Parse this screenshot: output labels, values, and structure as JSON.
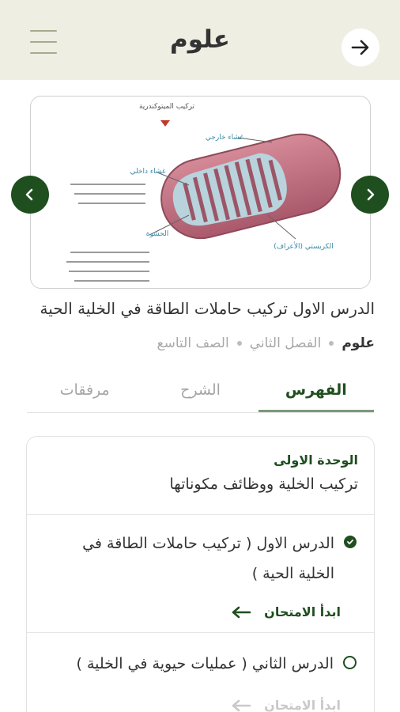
{
  "header": {
    "title": "علوم",
    "menu_icon": "hamburger-icon",
    "back_icon": "arrow-right-icon"
  },
  "slider": {
    "image_labels": {
      "top": "تركيب الميتوكندرية",
      "outer_membrane": "غشاء خارجي",
      "inner_membrane": "غشاء داخلي",
      "matrix": "الحشوة",
      "cristae": "الكريستي (الأعراف)"
    },
    "prev_icon": "chevron-left-icon",
    "next_icon": "chevron-right-icon"
  },
  "lesson": {
    "title": "الدرس الاول تركيب حاملات الطاقة في الخلية الحية",
    "subject": "علوم",
    "semester": "الفصل الثاني",
    "grade": "الصف التاسع"
  },
  "tabs": [
    {
      "label": "الفهرس",
      "active": true
    },
    {
      "label": "الشرح",
      "active": false
    },
    {
      "label": "مرفقات",
      "active": false
    }
  ],
  "index": {
    "unit_label": "الوحدة الاولى",
    "unit_title": "تركيب الخلية ووظائف مكوناتها",
    "lessons": [
      {
        "line1": "الدرس الاول ( تركيب حاملات الطاقة في",
        "line2": "الخلية الحية )",
        "done": true,
        "exam_label": "ابدأ الامتحان",
        "exam_enabled": true
      },
      {
        "line1": "الدرس الثاني ( عمليات حيوية في الخلية )",
        "line2": "",
        "done": false,
        "exam_label": "ابدأ الامتحان",
        "exam_enabled": false
      }
    ]
  },
  "colors": {
    "header_bg": "#eeeee3",
    "accent": "#1f4e1f",
    "muted": "#a8a8a8"
  }
}
